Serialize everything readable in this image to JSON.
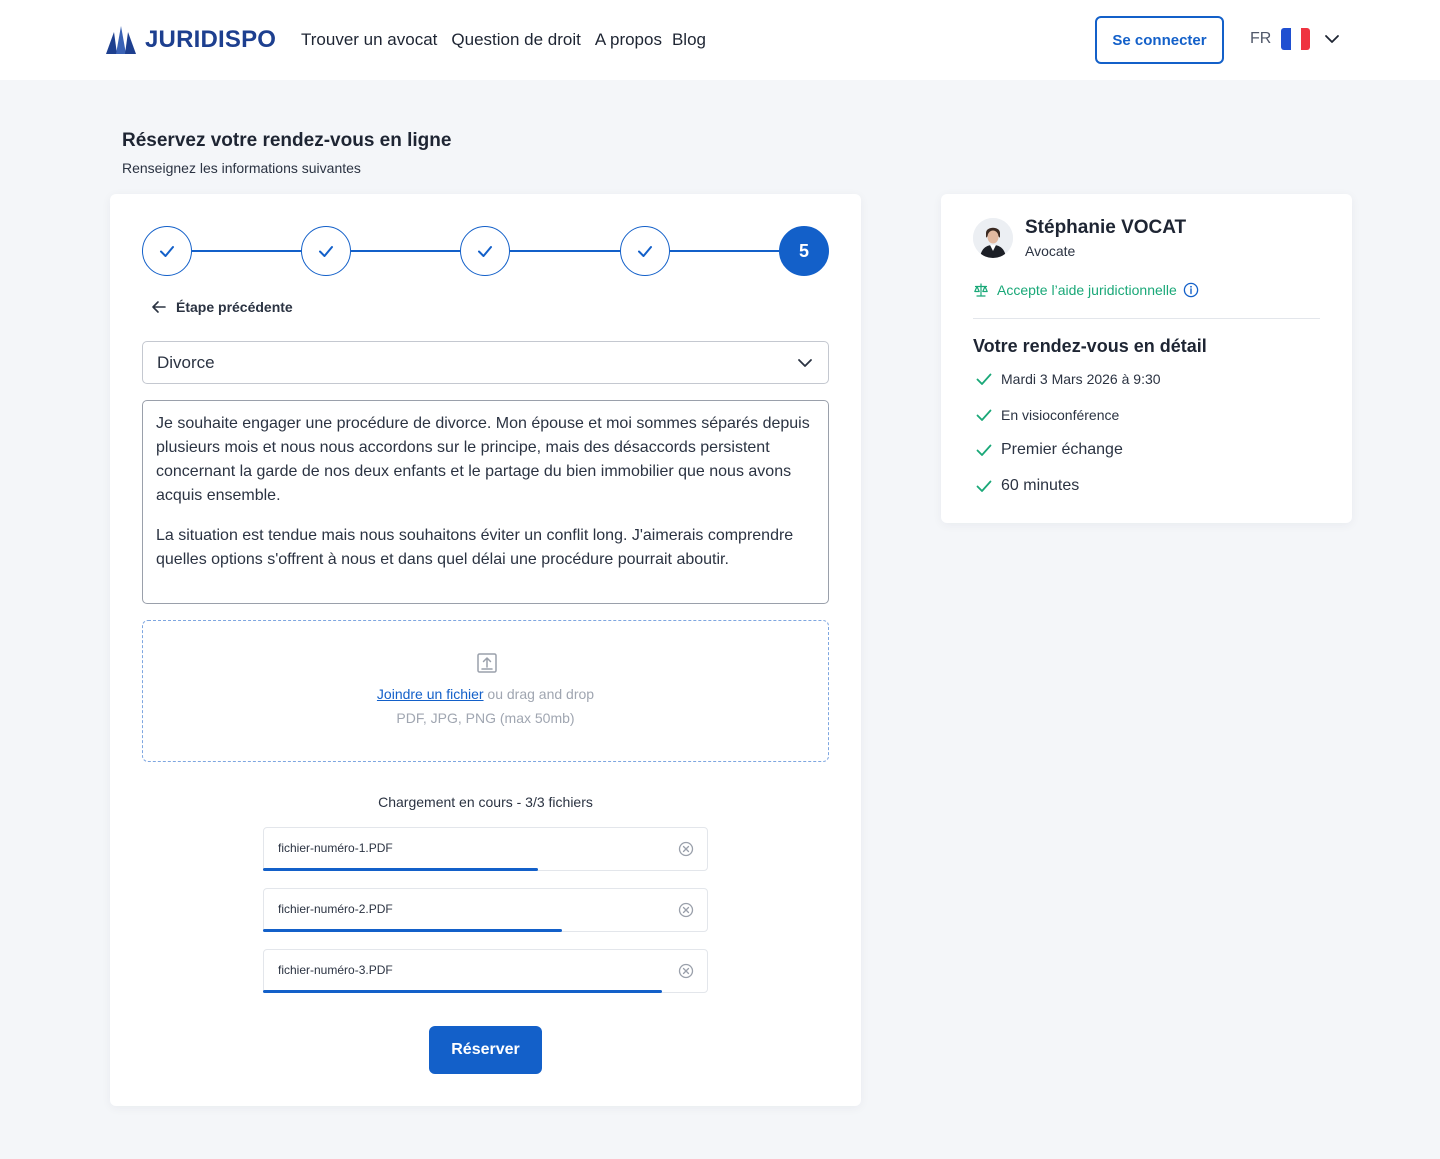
{
  "header": {
    "brand": "JURIDISPO",
    "nav": [
      "Trouver un avocat",
      "Question de droit",
      "A propos",
      "Blog"
    ],
    "login_label": "Se connecter",
    "language": "FR",
    "flag_colors": [
      "#1f4fd1",
      "#ffffff",
      "#ef3340"
    ]
  },
  "page": {
    "title": "Réservez votre rendez-vous en ligne",
    "subtitle": "Renseignez les informations suivantes"
  },
  "form": {
    "steps": [
      "done",
      "done",
      "done",
      "done",
      "5"
    ],
    "back_label": "Étape précédente",
    "category_value": "Divorce",
    "message_paragraphs": [
      "Je souhaite engager une procédure de divorce. Mon épouse et moi sommes séparés depuis plusieurs mois et nous nous accordons sur le principe, mais des désaccords persistent concernant la garde de nos deux enfants et le partage du bien immobilier que nous avons acquis ensemble.",
      "La situation est tendue mais nous souhaitons éviter un conflit long. J'aimerais comprendre quelles options s'offrent à nous et dans quel délai une procédure pourrait aboutir."
    ],
    "dropzone": {
      "link_label": "Joindre un fichier",
      "drag_text": " ou drag and drop",
      "formats": "PDF, JPG, PNG (max 50mb)"
    },
    "upload_status": "Chargement en cours -  3/3 fichiers",
    "files": [
      {
        "name": "fichier-numéro-1.PDF",
        "progress": 0.62
      },
      {
        "name": "fichier-numéro-2.PDF",
        "progress": 0.675
      },
      {
        "name": "fichier-numéro-3.PDF",
        "progress": 0.9
      }
    ],
    "submit_label": "Réserver"
  },
  "lawyer": {
    "name": "Stéphanie VOCAT",
    "role": "Avocate",
    "legal_aid": "Accepte l’aide juridictionnelle",
    "detail_title": "Votre rendez-vous en détail",
    "details": [
      "Mardi 3 Mars 2026 à 9:30",
      "En visioconférence",
      "Premier échange",
      "60 minutes"
    ]
  },
  "colors": {
    "accent": "#1360c9",
    "success": "#1aa878"
  }
}
